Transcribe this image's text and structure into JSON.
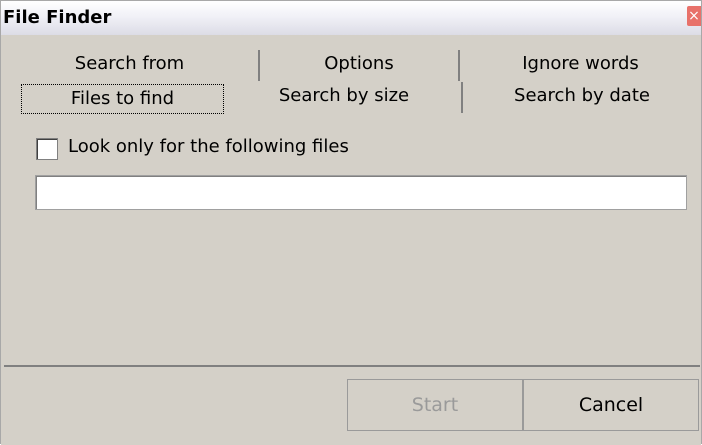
{
  "window": {
    "title": "File Finder",
    "close_symbol": "×"
  },
  "tabs": {
    "row1": [
      {
        "label": "Search from"
      },
      {
        "label": "Options"
      },
      {
        "label": "Ignore words"
      }
    ],
    "row2": [
      {
        "label": "Files to find",
        "active": true
      },
      {
        "label": "Search by size"
      },
      {
        "label": "Search by date"
      }
    ]
  },
  "panel": {
    "checkbox_label": "Look only for the following files",
    "checkbox_checked": false,
    "files_input_value": ""
  },
  "footer": {
    "start_label": "Start",
    "start_enabled": false,
    "cancel_label": "Cancel"
  },
  "colors": {
    "close_button": "#e8716a",
    "face": "#d4d0c8"
  }
}
